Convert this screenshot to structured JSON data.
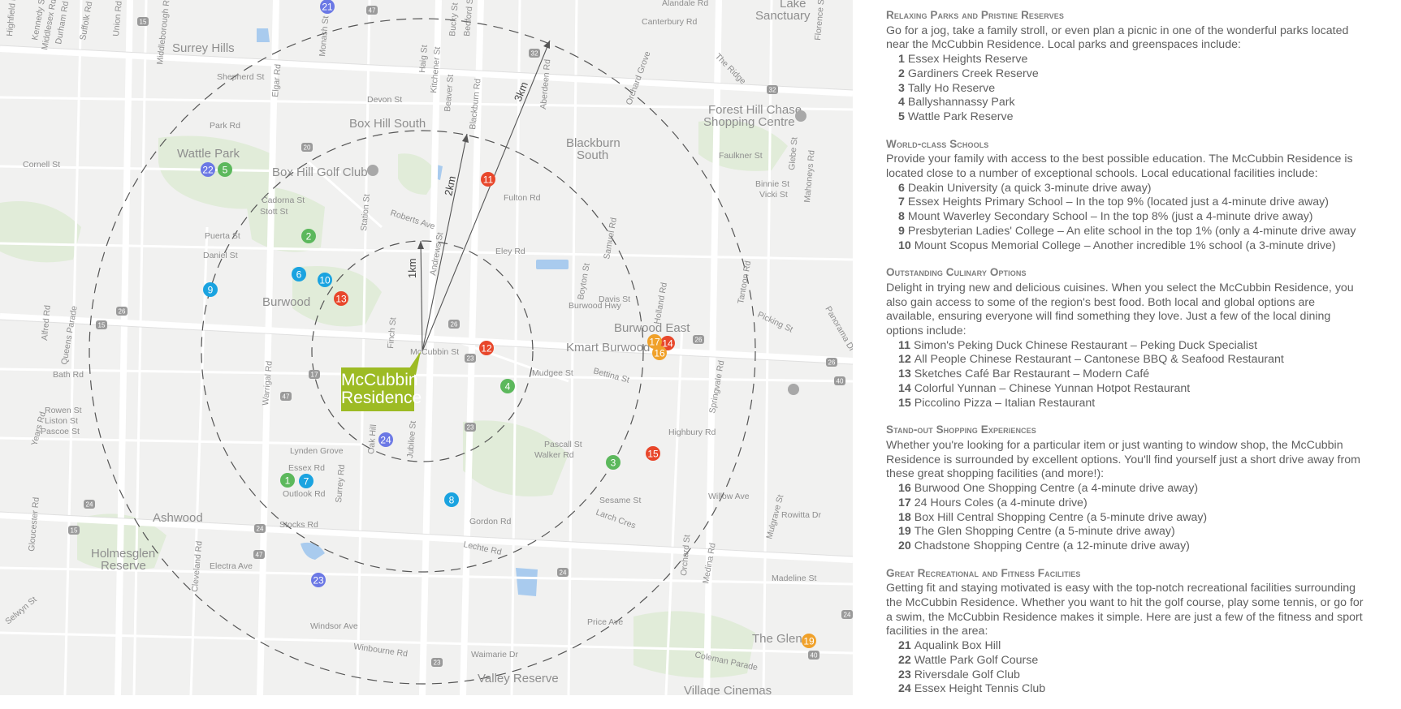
{
  "map": {
    "brand": {
      "line1": "McCubbin",
      "line2": "Residence"
    },
    "rings": [
      "1km",
      "2km",
      "3km"
    ],
    "suburbs": [
      "Surrey Hills",
      "Box Hill South",
      "Blackburn",
      "South",
      "Burwood",
      "Burwood East",
      "Ashwood",
      "Holmesglen",
      "Reserve",
      "Wattle Park",
      "Box Hill Golf Club",
      "Forest Hill Chase",
      "Shopping Centre",
      "Kmart Burwood",
      "The Glen",
      "Valley Reserve",
      "Village Cinemas",
      "Lake",
      "Sanctuary"
    ],
    "streets": [
      "Elgar Rd",
      "Station St",
      "Canterbury Rd",
      "Burwood Hwy",
      "Highbury Rd",
      "Eley Rd",
      "Warrigal Rd",
      "Blackburn Rd",
      "Middleborough Rd",
      "Springvale Rd",
      "Mahoneys Rd",
      "Stott St",
      "Cadorna St",
      "Roberts Ave",
      "Fulton Rd",
      "Davis St",
      "Holland Rd",
      "Essex Rd",
      "Lynden Grove",
      "Outlook Rd",
      "Stocks Rd",
      "Electra Ave",
      "Gordon Rd",
      "Lechte Rd",
      "Windsor Ave",
      "Winbourne Rd",
      "Waimarie Dr",
      "Price Ave",
      "Coleman Parade",
      "McCubbin St",
      "Mudgee St",
      "Bettina St",
      "Pascall St",
      "Walker Rd",
      "Sesame St",
      "Larch Cres",
      "Willow Ave",
      "Rowitta Dr",
      "Madeline St",
      "Picking St",
      "Faulkner St",
      "Devon St",
      "Park Rd",
      "Shepherd St",
      "Puerta St",
      "Daniel St",
      "Cornell St",
      "Alfred Rd",
      "Queens Parade",
      "Bath Rd",
      "Rowen St",
      "Liston St",
      "Pascoe St",
      "Years Rd",
      "Gloucester Rd",
      "Cleveland Rd",
      "Surrey Rd",
      "Oak Hill",
      "Jubilee St",
      "Finch St",
      "Andrews St",
      "Samuel Rd",
      "Boyton St",
      "Tantoon Rd",
      "Orchard St",
      "Medina Rd",
      "Mulgrave St",
      "Selwyn St",
      "Highfield Rd",
      "Kennedy St",
      "Middlesex Rd",
      "Durham Rd",
      "Suffolk Rd",
      "Union Rd",
      "Monash St",
      "Haig St",
      "Kitchener St",
      "Beaver St",
      "Bucky St",
      "Bedford St",
      "Aberdeen Rd",
      "Orchard Grove",
      "The Ridge",
      "Glebe St",
      "Florence St",
      "Binnie St",
      "Vicki St",
      "Alandale Rd",
      "Panorama Dr"
    ],
    "markers": [
      {
        "n": "1",
        "cat": "park"
      },
      {
        "n": "2",
        "cat": "park"
      },
      {
        "n": "3",
        "cat": "park"
      },
      {
        "n": "4",
        "cat": "park"
      },
      {
        "n": "5",
        "cat": "park"
      },
      {
        "n": "6",
        "cat": "school"
      },
      {
        "n": "7",
        "cat": "school"
      },
      {
        "n": "8",
        "cat": "school"
      },
      {
        "n": "9",
        "cat": "school"
      },
      {
        "n": "10",
        "cat": "school"
      },
      {
        "n": "11",
        "cat": "food"
      },
      {
        "n": "12",
        "cat": "food"
      },
      {
        "n": "13",
        "cat": "food"
      },
      {
        "n": "14",
        "cat": "food"
      },
      {
        "n": "15",
        "cat": "food"
      },
      {
        "n": "16",
        "cat": "shop"
      },
      {
        "n": "17",
        "cat": "shop"
      },
      {
        "n": "19",
        "cat": "shop"
      },
      {
        "n": "21",
        "cat": "rec"
      },
      {
        "n": "22",
        "cat": "rec"
      },
      {
        "n": "23",
        "cat": "rec"
      },
      {
        "n": "24",
        "cat": "rec"
      }
    ],
    "colors": {
      "park": "#5cb85c",
      "school": "#1aa3e0",
      "food": "#e8472b",
      "shop": "#f0a12a",
      "rec": "#6b78e5",
      "brand": "#9dbb24"
    }
  },
  "sections": [
    {
      "title": "Relaxing Parks and Pristine Reserves",
      "intro": "Go for a jog, take a family stroll, or even plan a picnic in one of the wonderful parks located near the McCubbin Residence. Local parks and greenspaces include:",
      "items": [
        {
          "n": "1",
          "text": "Essex Heights Reserve"
        },
        {
          "n": "2",
          "text": "Gardiners Creek Reserve"
        },
        {
          "n": "3",
          "text": "Tally Ho Reserve"
        },
        {
          "n": "4",
          "text": "Ballyshannassy Park"
        },
        {
          "n": "5",
          "text": "Wattle Park Reserve"
        }
      ]
    },
    {
      "title": "World-class Schools",
      "intro": "Provide your family with access to the best possible education. The McCubbin Residence is located close to a number of exceptional schools. Local educational facilities include:",
      "items": [
        {
          "n": "6",
          "text": "Deakin University (a quick 3-minute drive away)"
        },
        {
          "n": "7",
          "text": "Essex Heights Primary School – In the top 9% (located just a 4-minute drive away)"
        },
        {
          "n": "8",
          "text": "Mount Waverley Secondary School – In the top 8% (just a 4-minute drive away)"
        },
        {
          "n": "9",
          "text": "Presbyterian Ladies' College – An elite school in the top 1% (only a 4-minute drive away"
        },
        {
          "n": "10",
          "text": "Mount Scopus Memorial College – Another incredible 1% school (a 3-minute drive)"
        }
      ]
    },
    {
      "title": "Outstanding Culinary Options",
      "intro": "Delight in trying new and delicious cuisines. When you select the McCubbin Residence, you also gain access to some of the region's best food. Both local and global options are available, ensuring everyone will find something they love. Just a few of the local dining options include:",
      "items": [
        {
          "n": "11",
          "text": "Simon's Peking Duck Chinese Restaurant – Peking Duck Specialist"
        },
        {
          "n": "12",
          "text": "All People Chinese Restaurant – Cantonese BBQ & Seafood Restaurant"
        },
        {
          "n": "13",
          "text": "Sketches Café Bar Restaurant – Modern Café"
        },
        {
          "n": "14",
          "text": "Colorful Yunnan – Chinese Yunnan Hotpot Restaurant"
        },
        {
          "n": "15",
          "text": "Piccolino Pizza – Italian Restaurant"
        }
      ]
    },
    {
      "title": "Stand-out Shopping Experiences",
      "intro": "Whether you're looking for a particular item or just wanting to window shop, the McCubbin Residence is surrounded by excellent options. You'll find yourself just a short drive away from these great shopping facilities (and more!):",
      "items": [
        {
          "n": "16",
          "text": "Burwood One Shopping Centre (a 4-minute drive away)"
        },
        {
          "n": "17",
          "text": "24 Hours Coles (a 4-minute drive)"
        },
        {
          "n": "18",
          "text": "Box Hill Central Shopping Centre (a 5-minute drive away)"
        },
        {
          "n": "19",
          "text": "The Glen Shopping Centre (a 5-minute drive away)"
        },
        {
          "n": "20",
          "text": "Chadstone Shopping Centre (a 12-minute drive away)"
        }
      ]
    },
    {
      "title": "Great Recreational and Fitness Facilities",
      "intro": "Getting fit and staying motivated is easy with the top-notch recreational facilities surrounding the McCubbin Residence. Whether you want to hit the golf course, play some tennis, or go for a swim, the McCubbin Residence makes it simple. Here are just a few of the fitness and sport facilities in the area:",
      "items": [
        {
          "n": "21",
          "text": "Aqualink Box Hill"
        },
        {
          "n": "22",
          "text": "Wattle Park Golf Course"
        },
        {
          "n": "23",
          "text": "Riversdale Golf Club"
        },
        {
          "n": "24",
          "text": "Essex Height Tennis Club"
        }
      ]
    }
  ]
}
